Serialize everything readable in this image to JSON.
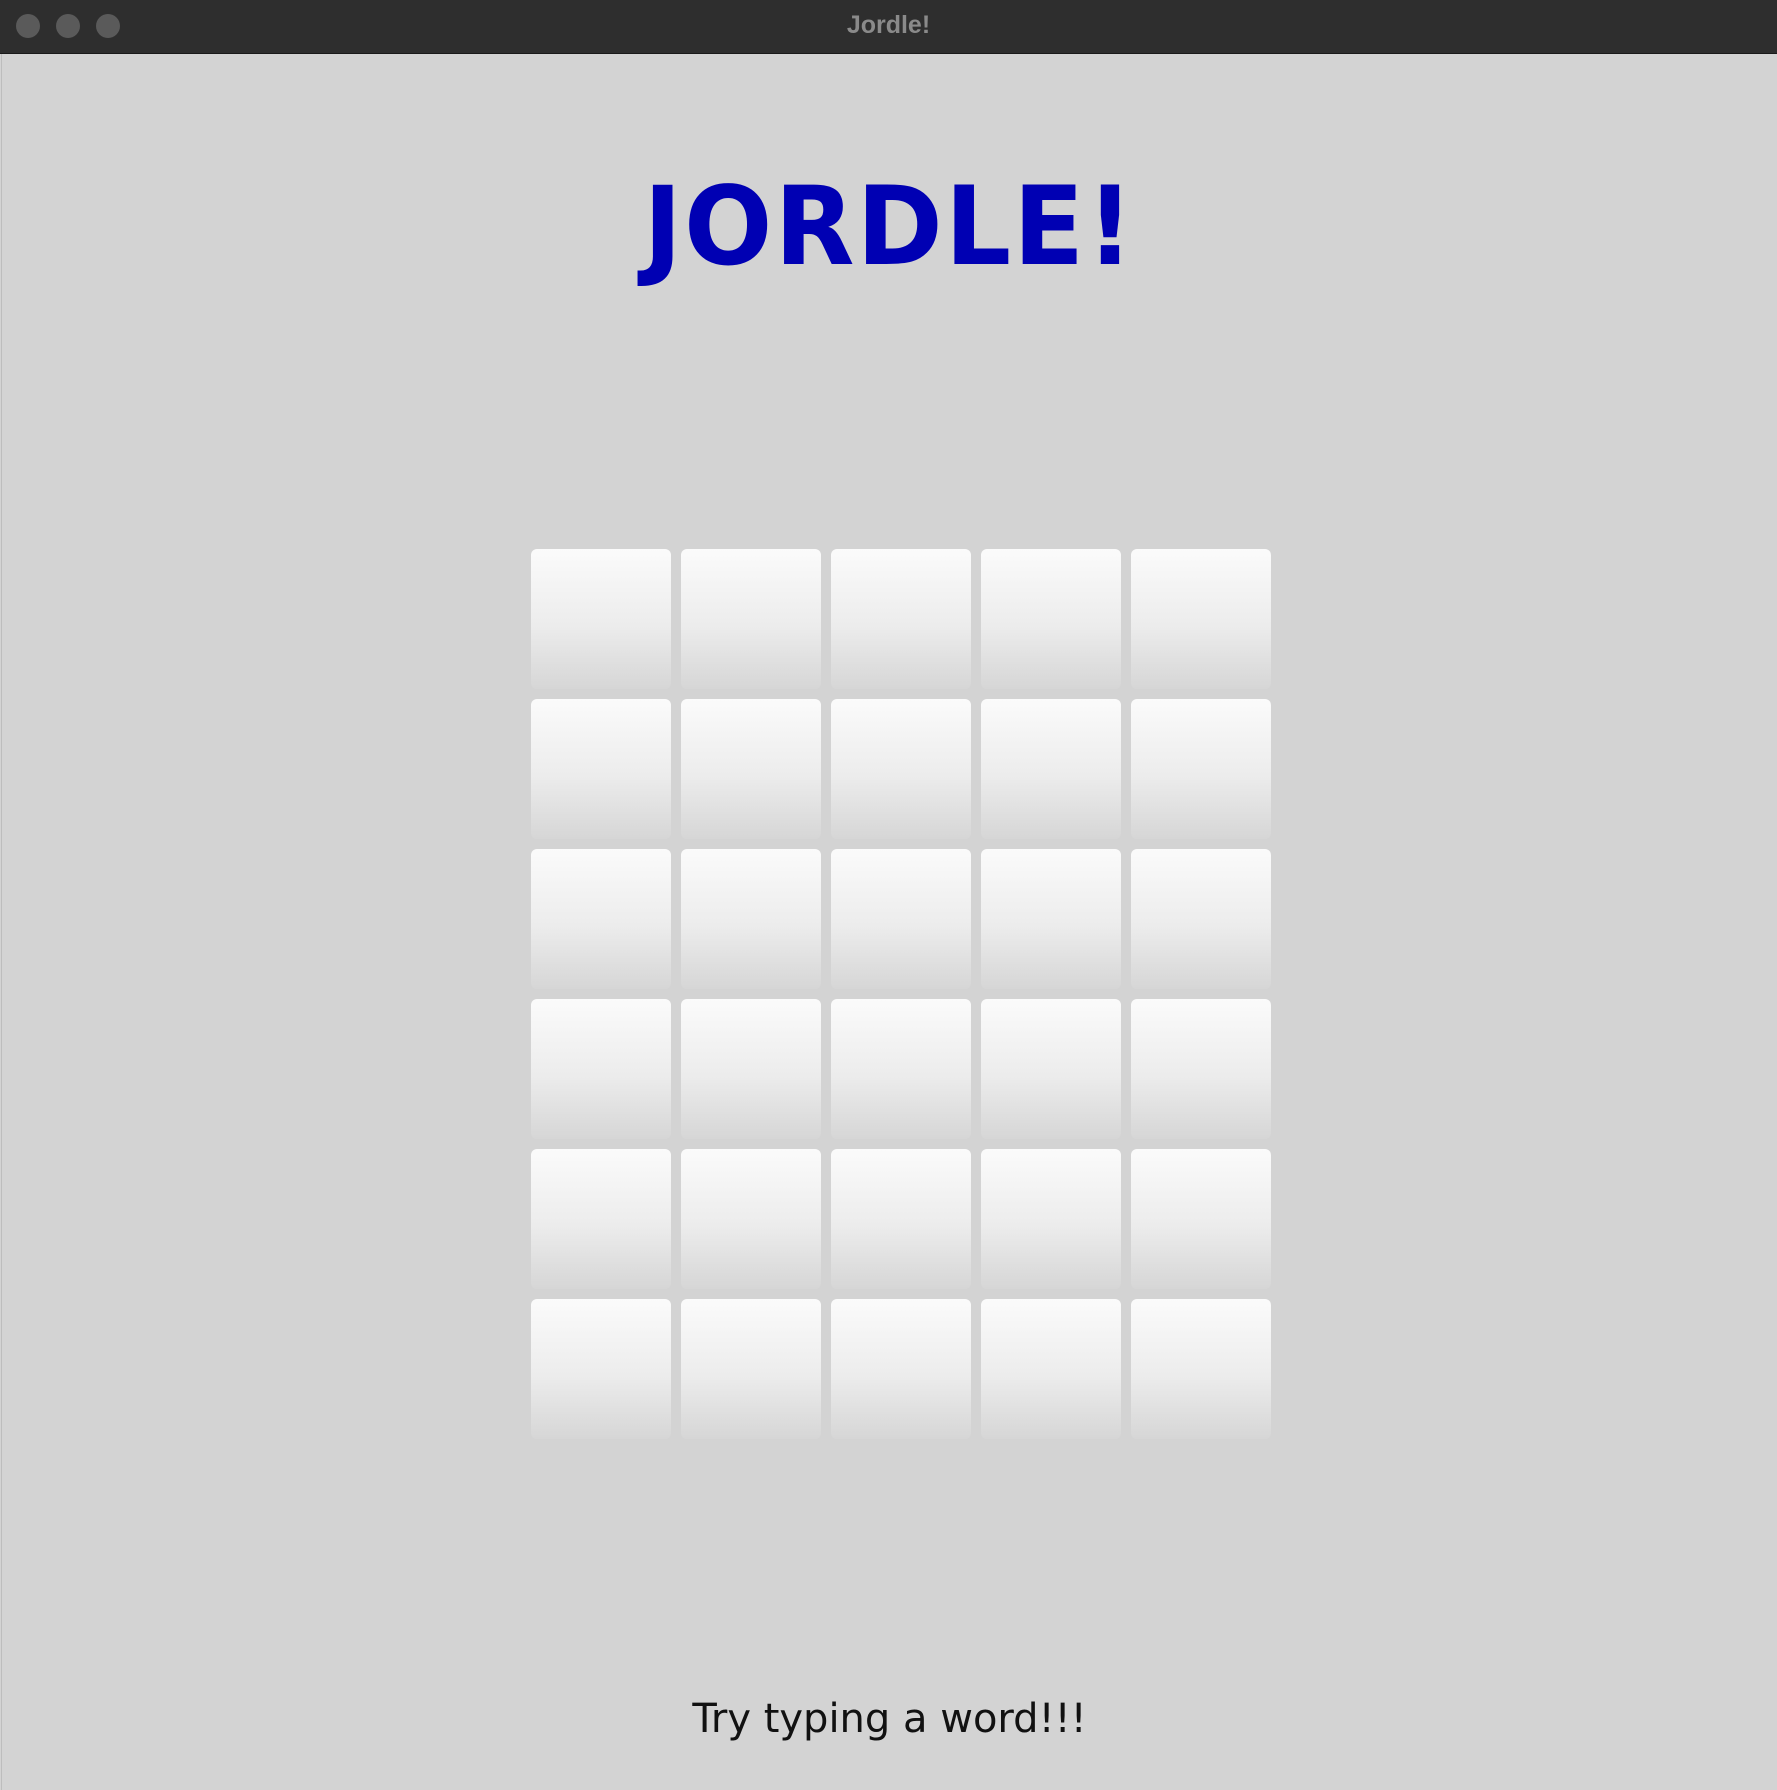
{
  "window": {
    "title": "Jordle!"
  },
  "game": {
    "title": "JORDLE!",
    "title_color": "#0000B3",
    "status_message": "Try typing a word!!!",
    "board": {
      "rows": [
        [
          "",
          "",
          "",
          "",
          ""
        ],
        [
          "",
          "",
          "",
          "",
          ""
        ],
        [
          "",
          "",
          "",
          "",
          ""
        ],
        [
          "",
          "",
          "",
          "",
          ""
        ],
        [
          "",
          "",
          "",
          "",
          ""
        ],
        [
          "",
          "",
          "",
          "",
          ""
        ]
      ]
    }
  }
}
